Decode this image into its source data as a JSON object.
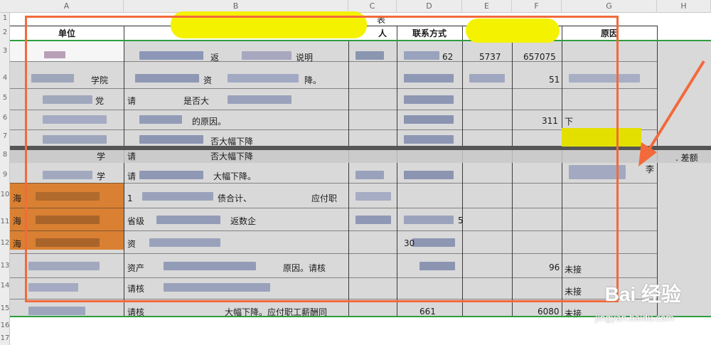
{
  "columns": [
    "A",
    "B",
    "C",
    "D",
    "E",
    "F",
    "G",
    "H"
  ],
  "rows": [
    "1",
    "2",
    "3",
    "4",
    "5",
    "6",
    "7",
    "8",
    "9",
    "10",
    "11",
    "12",
    "13",
    "14",
    "15",
    "16",
    "17"
  ],
  "header": {
    "unit": "单位",
    "contact_person_fragment": "人",
    "contact": "联系方式",
    "reason": "原因",
    "title_fragment": "表"
  },
  "cells": {
    "r3_b": "返",
    "r3_b2": "说明",
    "r3_d": "62",
    "r3_e": "5737",
    "r3_f": "657075",
    "r4_a": "学院",
    "r4_b": "资",
    "r4_b2": "降。",
    "r4_f": "51",
    "r5_a": "党",
    "r5_b": "请",
    "r5_b2": "是否大",
    "r6_b": "的原因。",
    "r6_f": "311",
    "r6_g": "下",
    "r7_b": "否大幅下降",
    "r8_a": "学",
    "r8_b": "请",
    "r8_b2": "否大幅下降",
    "r8_g": "李",
    "r8_h": ". 差额",
    "r9_a": "学",
    "r9_b": "请",
    "r9_b2": "大幅下降。",
    "r10_a": "海",
    "r10_b": "1",
    "r10_b2": "债合计、",
    "r10_b3": "应付职",
    "r11_a": "海",
    "r11_b": "省级",
    "r11_b2": "返数企",
    "r11_d": "5",
    "r12_a": "海",
    "r12_b": "资",
    "r12_d": "30",
    "r13_b": "资产",
    "r13_b2": "原因。请核",
    "r13_f": "96",
    "r13_g": "未接",
    "r14_b": "请核",
    "r14_g": "未接",
    "r15_b": "请核",
    "r15_b2": "大幅下降。应付职工薪酬同",
    "r15_d": "661",
    "r15_f": "6080",
    "r15_g": "未接"
  },
  "watermark": {
    "logo": "Bai 经验",
    "url": "jingyan.baidu.com"
  },
  "colors": {
    "annotation_red": "#f26a3b",
    "highlight_yellow": "#f5f200",
    "fill_orange": "#d98033"
  }
}
